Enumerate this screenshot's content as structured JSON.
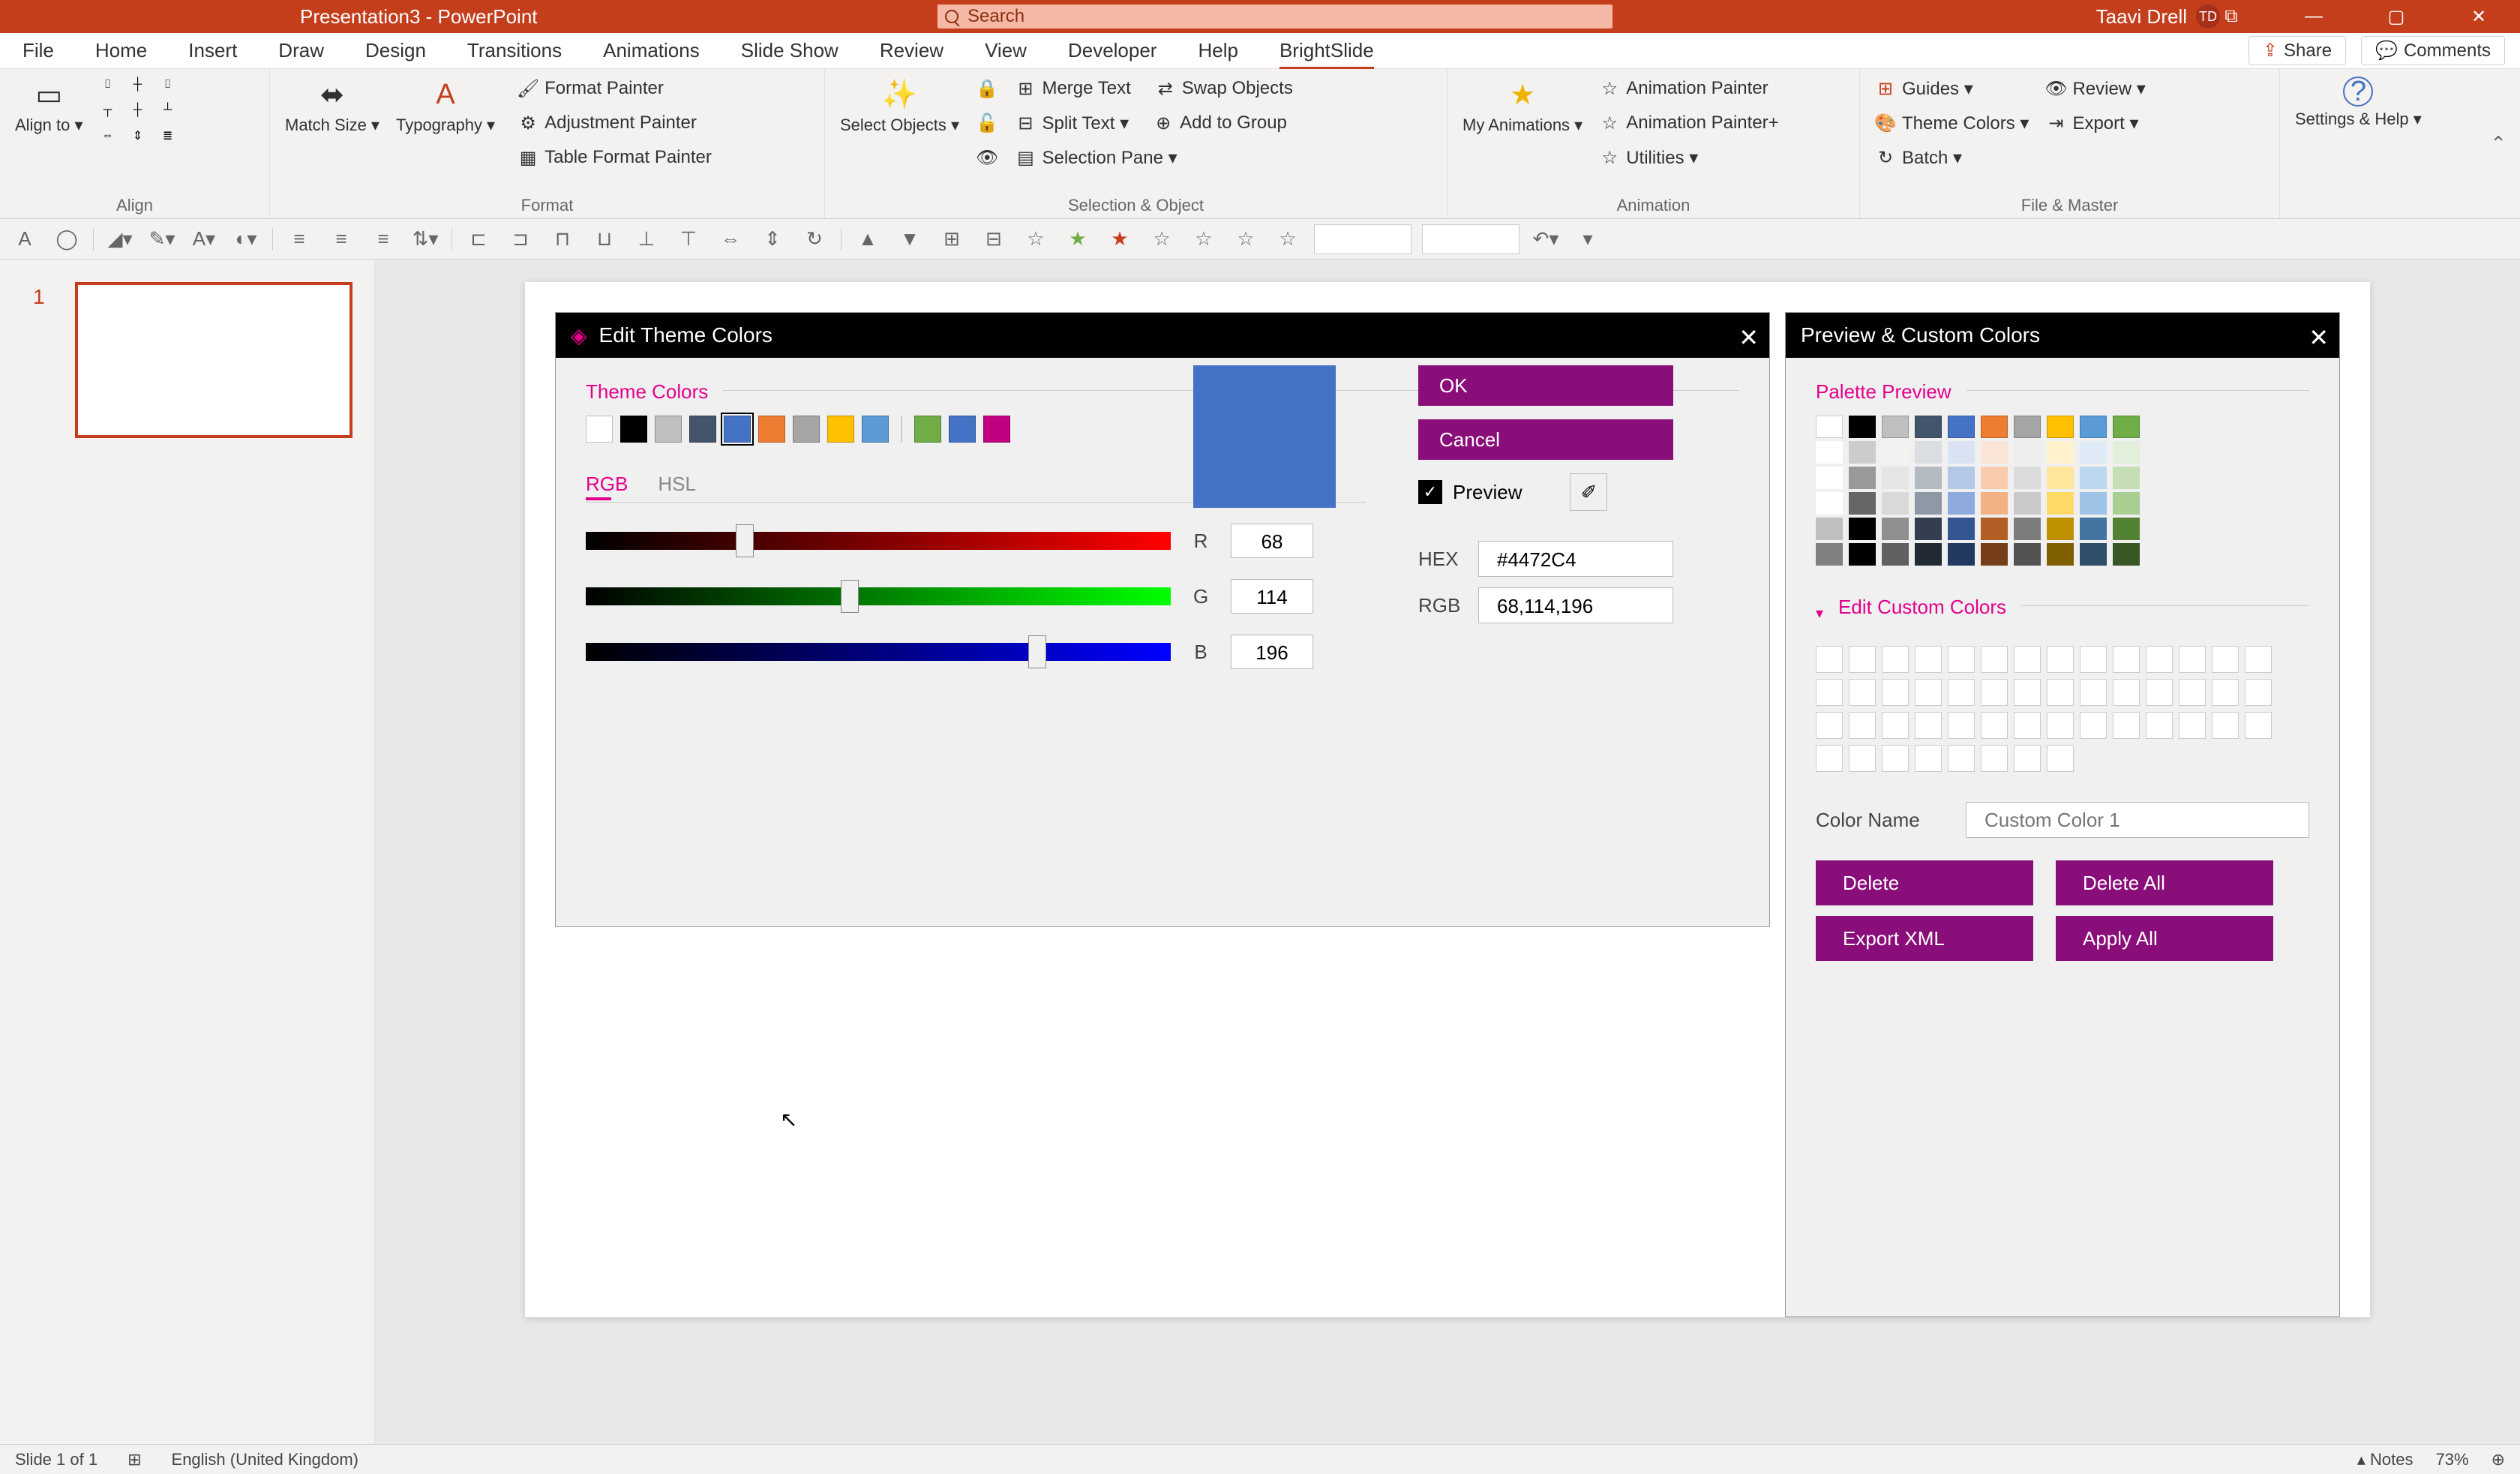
{
  "title": "Presentation3  -  PowerPoint",
  "search_placeholder": "Search",
  "user": {
    "name": "Taavi Drell",
    "initials": "TD"
  },
  "tabs": [
    "File",
    "Home",
    "Insert",
    "Draw",
    "Design",
    "Transitions",
    "Animations",
    "Slide Show",
    "Review",
    "View",
    "Developer",
    "Help",
    "BrightSlide"
  ],
  "active_tab": "BrightSlide",
  "share": "Share",
  "comments": "Comments",
  "ribbon": {
    "align": {
      "label": "Align",
      "align_to": "Align to ▾",
      "match_size": "Match Size ▾",
      "typography": "Typography ▾"
    },
    "format": {
      "label": "Format",
      "format_painter": "Format Painter",
      "adjustment_painter": "Adjustment Painter",
      "table_format_painter": "Table Format Painter"
    },
    "selobj": {
      "label": "Selection & Object",
      "select_objects": "Select Objects ▾",
      "merge_text": "Merge Text",
      "swap_objects": "Swap Objects",
      "split_text": "Split Text ▾",
      "add_to_group": "Add to Group",
      "selection_pane": "Selection Pane ▾"
    },
    "animation": {
      "label": "Animation",
      "my_animations": "My Animations ▾",
      "animation_painter": "Animation Painter",
      "animation_painter_plus": "Animation Painter+",
      "utilities": "Utilities ▾"
    },
    "filemaster": {
      "label": "File & Master",
      "guides": "Guides ▾",
      "theme_colors": "Theme Colors ▾",
      "batch": "Batch ▾",
      "review": "Review ▾",
      "export": "Export ▾"
    },
    "settings": {
      "label": "Settings & Help ▾"
    }
  },
  "slide_num": "1",
  "dialog_theme": {
    "title": "Edit Theme Colors",
    "theme_colors": "Theme Colors",
    "rgb": "RGB",
    "hsl": "HSL",
    "r": "R",
    "g": "G",
    "b": "B",
    "r_val": "68",
    "g_val": "114",
    "b_val": "196",
    "ok": "OK",
    "cancel": "Cancel",
    "preview": "Preview",
    "hex_label": "HEX",
    "hex_val": "#4472C4",
    "rgb_label": "RGB",
    "rgb_val": "68,114,196",
    "swatches": [
      "#ffffff",
      "#000000",
      "#bfbfbf",
      "#44546a",
      "#4472c4",
      "#ed7d31",
      "#a5a5a5",
      "#ffc000",
      "#5b9bd5",
      "#70ad47",
      "#4472c4",
      "#c00080"
    ],
    "selected_idx": 4,
    "big_swatch": "#4472c4"
  },
  "dialog_preview": {
    "title": "Preview & Custom Colors",
    "palette_preview": "Palette Preview",
    "edit_custom": "Edit Custom Colors",
    "color_name_label": "Color Name",
    "color_name_placeholder": "Custom Color 1",
    "delete": "Delete",
    "delete_all": "Delete All",
    "export_xml": "Export XML",
    "apply_all": "Apply All",
    "palette_base": [
      "#ffffff",
      "#000000",
      "#bfbfbf",
      "#44546a",
      "#4472c4",
      "#ed7d31",
      "#a5a5a5",
      "#ffc000",
      "#5b9bd5",
      "#70ad47"
    ]
  },
  "status": {
    "slide": "Slide 1 of 1",
    "lang": "English (United Kingdom)",
    "notes": "Notes",
    "zoom": "73%"
  }
}
